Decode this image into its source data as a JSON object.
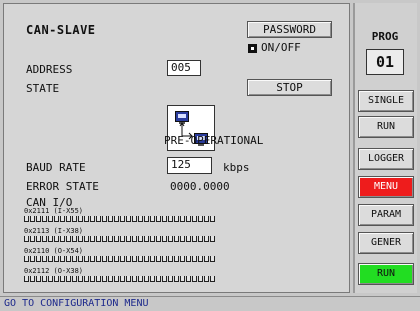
{
  "main": {
    "title": "CAN-SLAVE",
    "password_label": "PASSWORD",
    "onoff_label": "ON/OFF",
    "address_label": "ADDRESS",
    "address_value": "005",
    "state_label": "STATE",
    "stop_label": "STOP",
    "state_value": "PRE-OPERATIONAL",
    "baud_label": "BAUD RATE",
    "baud_value": "125",
    "baud_unit": "kbps",
    "error_label": "ERROR STATE",
    "error_value": "0000.0000",
    "canio_label": "CAN I/O",
    "registers": [
      {
        "label": "0x2111 (I-X55)",
        "bits": 32
      },
      {
        "label": "0x2113 (I-X38)",
        "bits": 32
      },
      {
        "label": "0x2110 (O-X54)",
        "bits": 32
      },
      {
        "label": "0x2112 (O-X38)",
        "bits": 32
      }
    ]
  },
  "sidebar": {
    "prog_label": "PROG",
    "prog_value": "01",
    "buttons": [
      {
        "label": "SINGLE",
        "color": "#dcdcdc"
      },
      {
        "label": "RUN",
        "color": "#dcdcdc"
      },
      {
        "label": "LOGGER",
        "color": "#dcdcdc"
      },
      {
        "label": "MENU",
        "color": "#ee1c1c"
      },
      {
        "label": "PARAM",
        "color": "#dcdcdc"
      },
      {
        "label": "GENER",
        "color": "#dcdcdc"
      },
      {
        "label": "RUN",
        "color": "#22dd22"
      }
    ]
  },
  "status": {
    "text": "GO TO CONFIGURATION MENU"
  }
}
